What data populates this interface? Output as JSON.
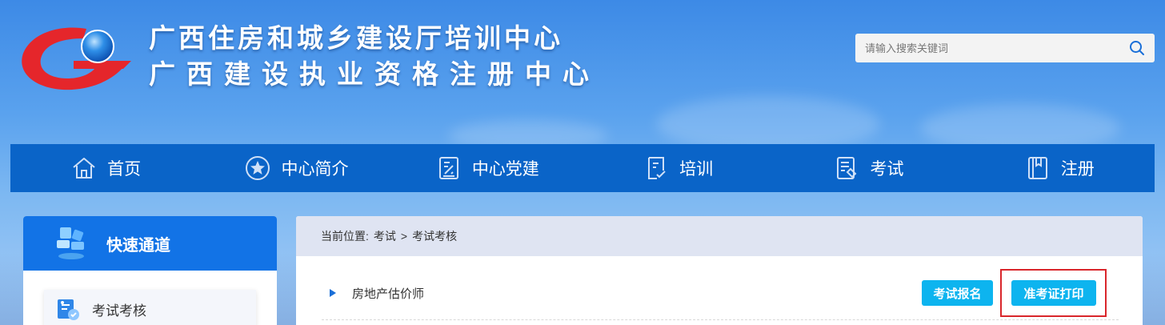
{
  "header": {
    "title_line1": "广西住房和城乡建设厅培训中心",
    "title_line2": "广西建设执业资格注册中心"
  },
  "search": {
    "placeholder": "请输入搜索关键词",
    "value": ""
  },
  "nav": {
    "items": [
      {
        "label": "首页",
        "icon": "home-icon"
      },
      {
        "label": "中心简介",
        "icon": "star-circle-icon"
      },
      {
        "label": "中心党建",
        "icon": "party-document-icon"
      },
      {
        "label": "培训",
        "icon": "clipboard-check-icon"
      },
      {
        "label": "考试",
        "icon": "exam-paper-icon"
      },
      {
        "label": "注册",
        "icon": "register-book-icon"
      }
    ]
  },
  "sidebar": {
    "title": "快速通道",
    "items": [
      {
        "label": "考试考核",
        "icon": "exam-badge-icon"
      }
    ]
  },
  "breadcrumb": {
    "prefix": "当前位置:",
    "items": [
      "考试",
      "考试考核"
    ],
    "separator": ">"
  },
  "list": {
    "rows": [
      {
        "name": "房地产估价师",
        "signup_label": "考试报名",
        "print_label": "准考证打印"
      }
    ]
  },
  "colors": {
    "nav_bg": "#0a64c8",
    "sidebar_head": "#1273e6",
    "button": "#0db4ef",
    "highlight_border": "#d9262b",
    "breadcrumb_bg": "#dfe4f2"
  }
}
